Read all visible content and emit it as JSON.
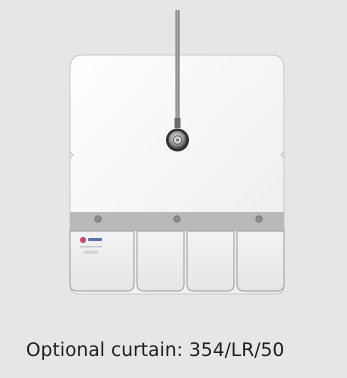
{
  "caption": {
    "text": "Optional curtain: 354/LR/50"
  },
  "product": {
    "logo_alt": "curtain label logo",
    "colors": {
      "background": "#e6e6e6",
      "panel": "#f7f7f8",
      "strip": "#b9b9bb",
      "flap": "#eeeef0",
      "rod": "#8a8a8a",
      "logo_accent": "#c8456a"
    },
    "flap_count": 4,
    "screw_count": 3
  }
}
